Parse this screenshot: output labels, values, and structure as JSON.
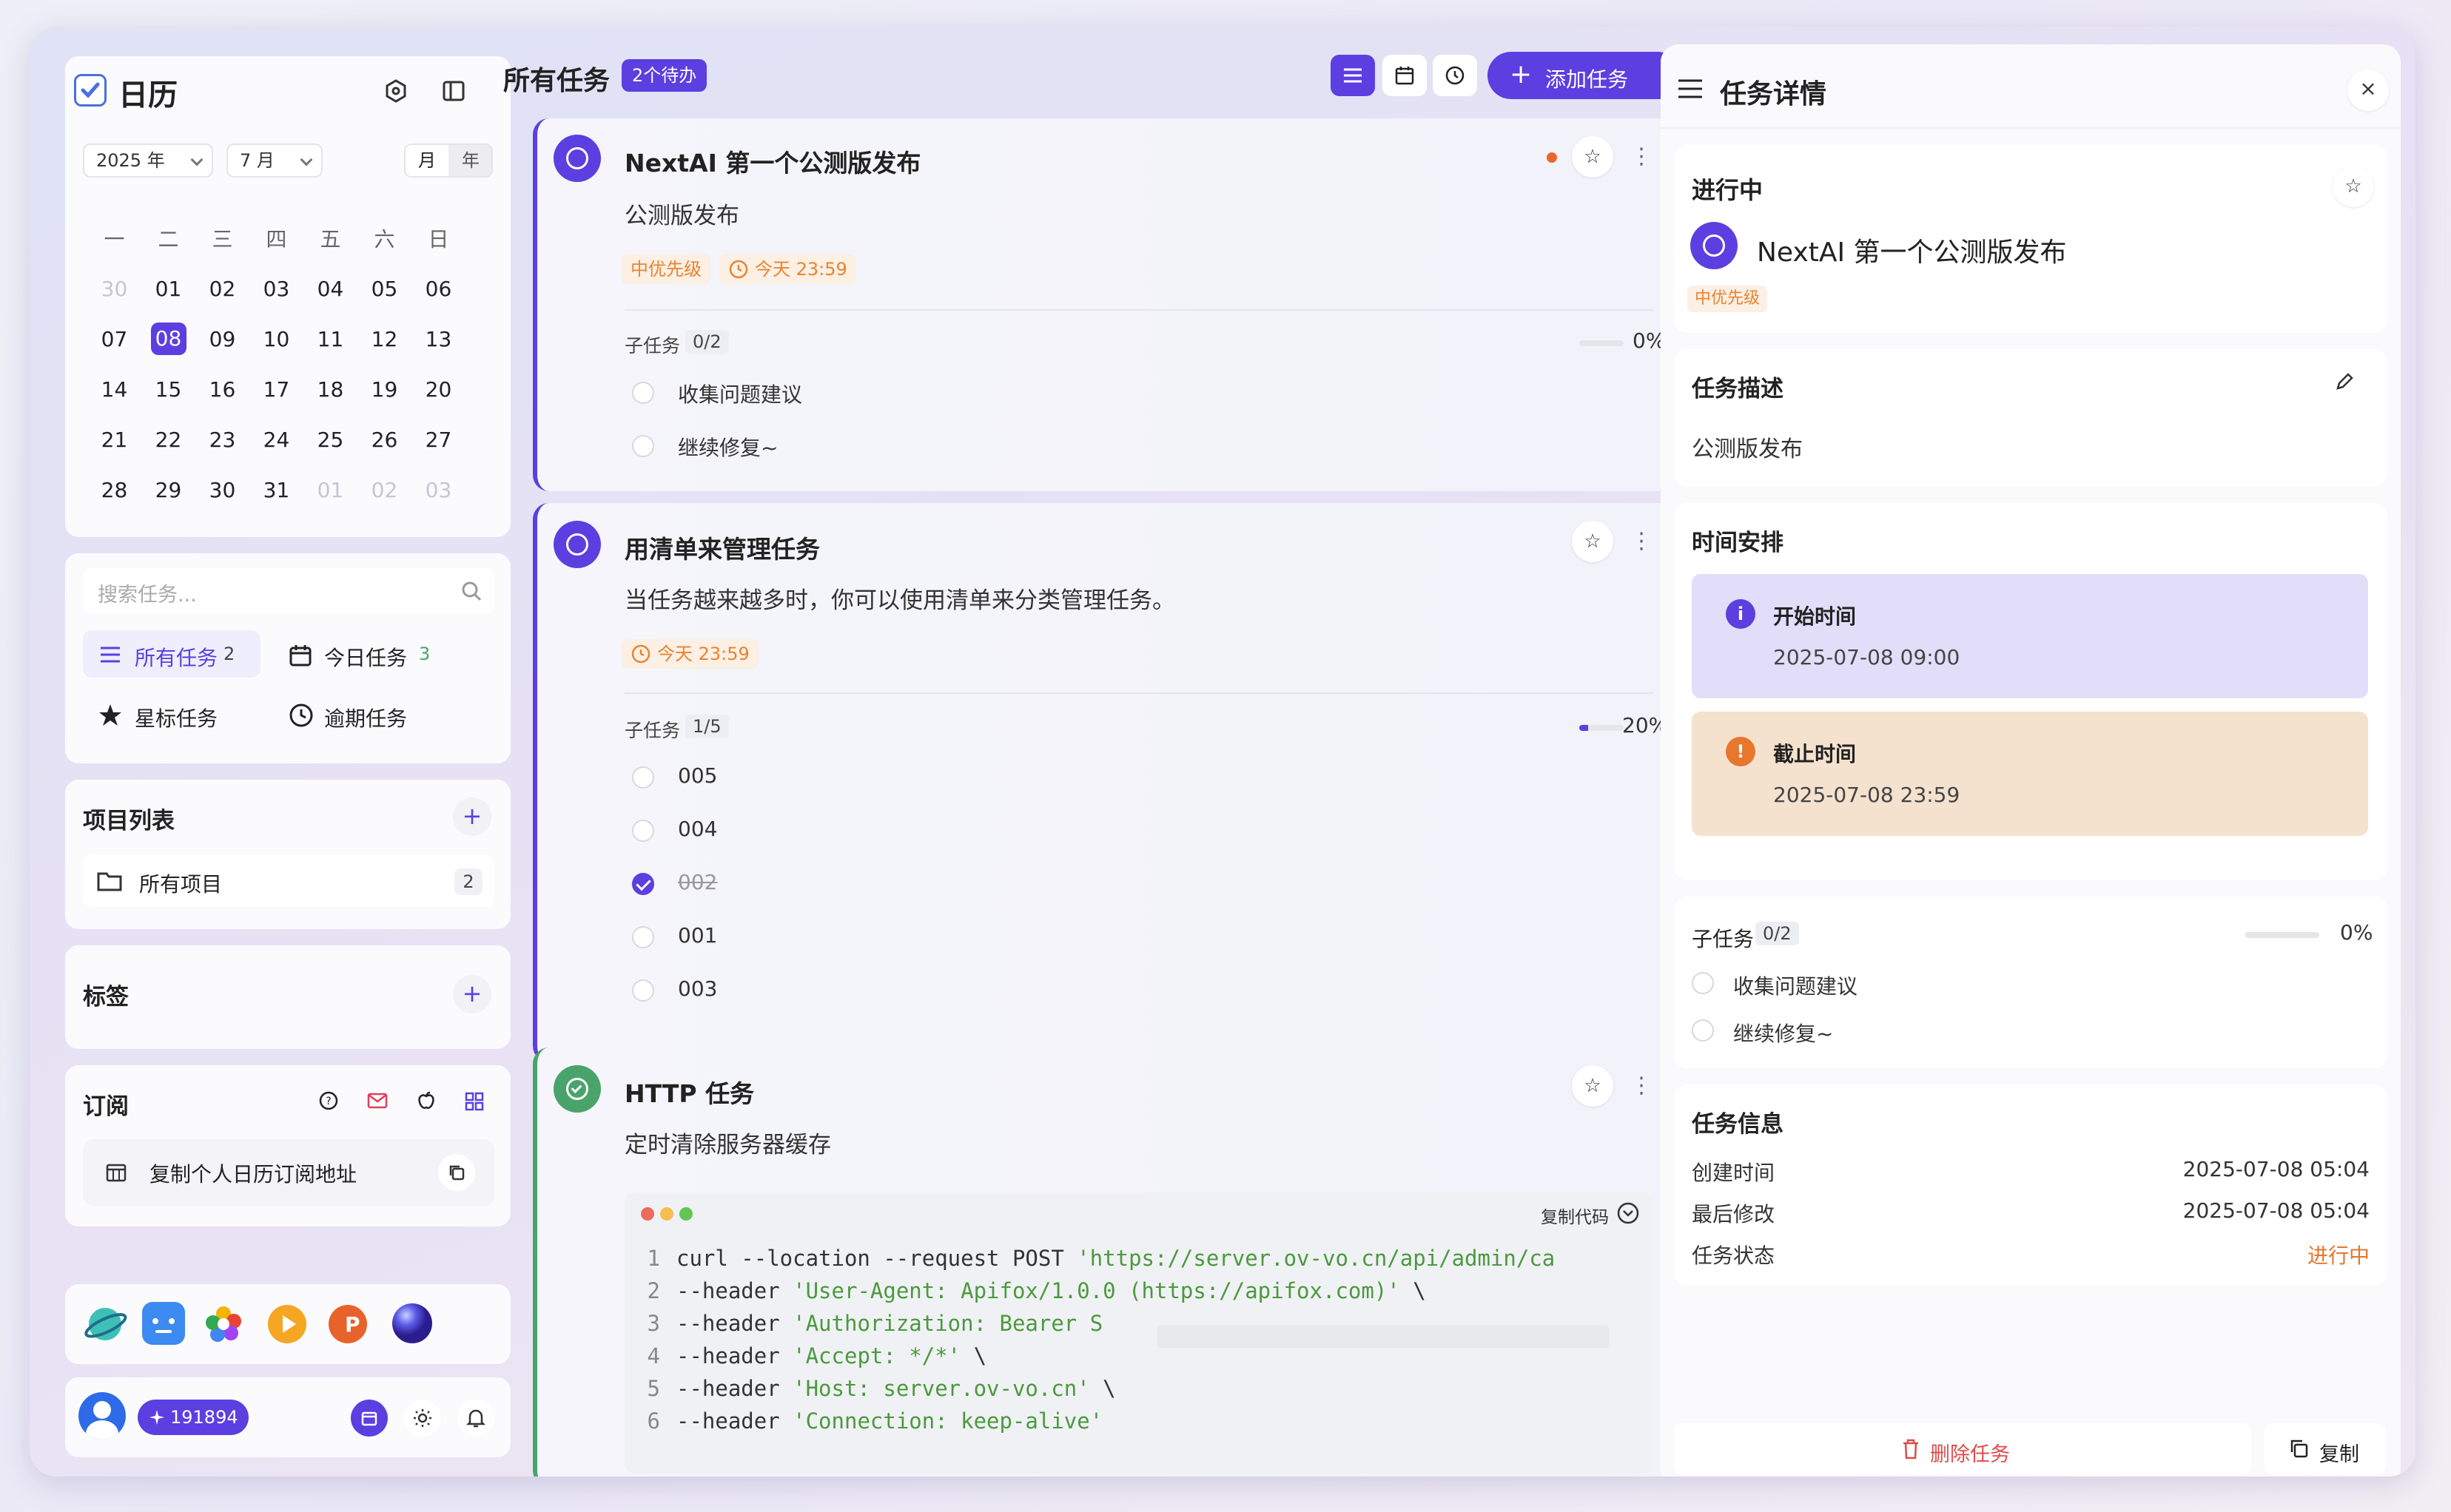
{
  "colors": {
    "accent": "#5b3fe0",
    "orange": "#e88432",
    "green": "#4aa36b",
    "danger": "#e04a4a"
  },
  "sidebar": {
    "title": "日历",
    "calendar": {
      "year_select": "2025 年",
      "month_select": "7 月",
      "view_month": "月",
      "view_year": "年",
      "weekdays": [
        "一",
        "二",
        "三",
        "四",
        "五",
        "六",
        "日"
      ],
      "weeks": [
        [
          "30",
          "01",
          "02",
          "03",
          "04",
          "05",
          "06"
        ],
        [
          "07",
          "08",
          "09",
          "10",
          "11",
          "12",
          "13"
        ],
        [
          "14",
          "15",
          "16",
          "17",
          "18",
          "19",
          "20"
        ],
        [
          "21",
          "22",
          "23",
          "24",
          "25",
          "26",
          "27"
        ],
        [
          "28",
          "29",
          "30",
          "31",
          "01",
          "02",
          "03"
        ]
      ],
      "selected": "08"
    },
    "search_placeholder": "搜索任务...",
    "nav": {
      "all": {
        "label": "所有任务",
        "count": "2"
      },
      "today": {
        "label": "今日任务",
        "count": "3"
      },
      "starred": {
        "label": "星标任务"
      },
      "overdue": {
        "label": "逾期任务"
      }
    },
    "projects": {
      "title": "项目列表",
      "add": "+",
      "item_label": "所有项目",
      "item_count": "2"
    },
    "tags": {
      "title": "标签",
      "add": "+"
    },
    "subscribe": {
      "title": "订阅",
      "copy_label": "复制个人日历订阅地址"
    },
    "user": {
      "points": "191894"
    }
  },
  "header": {
    "title": "所有任务",
    "badge": "2个待办",
    "add_button": "添加任务"
  },
  "tasks": [
    {
      "title": "NextAI 第一个公测版发布",
      "desc": "公测版发布",
      "priority": "中优先级",
      "due": "今天 23:59",
      "sub_label": "子任务",
      "sub_count": "0/2",
      "progress": 0,
      "progress_text": "0%",
      "subtasks": [
        {
          "label": "收集问题建议",
          "done": false
        },
        {
          "label": "继续修复~",
          "done": false
        }
      ]
    },
    {
      "title": "用清单来管理任务",
      "desc": "当任务越来越多时，你可以使用清单来分类管理任务。",
      "due": "今天 23:59",
      "sub_label": "子任务",
      "sub_count": "1/5",
      "progress": 0.2,
      "progress_text": "20%",
      "subtasks": [
        {
          "label": "005",
          "done": false
        },
        {
          "label": "004",
          "done": false
        },
        {
          "label": "002",
          "done": true
        },
        {
          "label": "001",
          "done": false
        },
        {
          "label": "003",
          "done": false
        }
      ]
    },
    {
      "title": "HTTP 任务",
      "desc": "定时清除服务器缓存",
      "copy_code": "复制代码",
      "code": [
        {
          "n": "1",
          "pre": "curl --location --request POST ",
          "s": "'https://server.ov-vo.cn/api/admin/ca",
          "post": ""
        },
        {
          "n": "2",
          "pre": "--header ",
          "s": "'User-Agent: Apifox/1.0.0 (https://apifox.com)'",
          "post": " \\"
        },
        {
          "n": "3",
          "pre": "--header ",
          "s": "'Authorization: Bearer S",
          "post": ""
        },
        {
          "n": "4",
          "pre": "--header ",
          "s": "'Accept: */*'",
          "post": " \\"
        },
        {
          "n": "5",
          "pre": "--header ",
          "s": "'Host: server.ov-vo.cn'",
          "post": " \\"
        },
        {
          "n": "6",
          "pre": "--header ",
          "s": "'Connection: keep-alive'",
          "post": ""
        }
      ]
    }
  ],
  "detail": {
    "title": "任务详情",
    "status": "进行中",
    "task_title": "NextAI 第一个公测版发布",
    "priority": "中优先级",
    "desc_title": "任务描述",
    "desc": "公测版发布",
    "schedule_title": "时间安排",
    "start_label": "开始时间",
    "start_value": "2025-07-08 09:00",
    "end_label": "截止时间",
    "end_value": "2025-07-08 23:59",
    "sub_label": "子任务",
    "sub_count": "0/2",
    "progress": 0,
    "progress_text": "0%",
    "subtasks": [
      "收集问题建议",
      "继续修复~"
    ],
    "info_title": "任务信息",
    "created_label": "创建时间",
    "created_value": "2025-07-08 05:04",
    "modified_label": "最后修改",
    "modified_value": "2025-07-08 05:04",
    "state_label": "任务状态",
    "state_value": "进行中",
    "delete_button": "删除任务",
    "copy_button": "复制"
  }
}
